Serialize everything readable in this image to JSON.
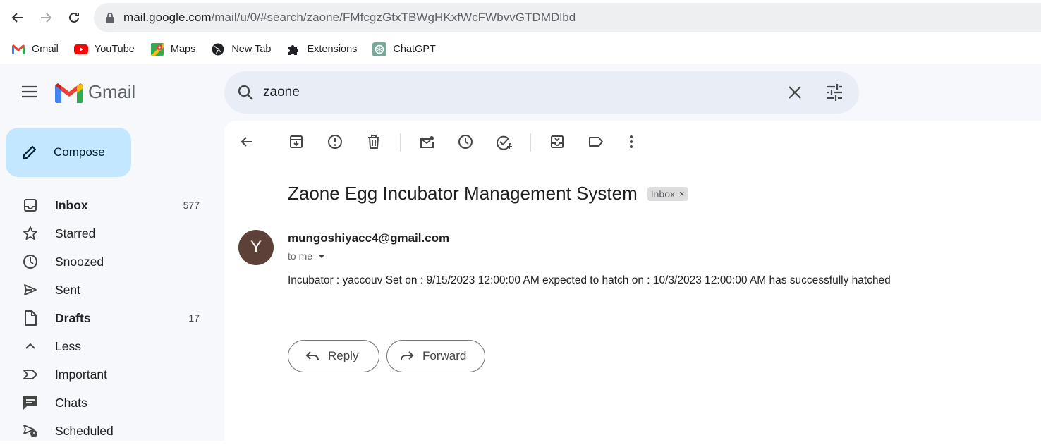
{
  "browser": {
    "url_host": "mail.google.com",
    "url_path": "/mail/u/0/#search/zaone/FMfcgzGtxTBWgHKxfWcFWbvvGTDMDlbd",
    "bookmarks": [
      "Gmail",
      "YouTube",
      "Maps",
      "New Tab",
      "Extensions",
      "ChatGPT"
    ]
  },
  "header": {
    "app_name": "Gmail",
    "search_value": "zaone"
  },
  "compose": {
    "label": "Compose"
  },
  "sidebar": {
    "items": [
      {
        "label": "Inbox",
        "count": "577",
        "icon": "inbox-icon"
      },
      {
        "label": "Starred",
        "count": "",
        "icon": "star-icon"
      },
      {
        "label": "Snoozed",
        "count": "",
        "icon": "clock-icon"
      },
      {
        "label": "Sent",
        "count": "",
        "icon": "send-icon"
      },
      {
        "label": "Drafts",
        "count": "17",
        "icon": "draft-icon"
      },
      {
        "label": "Less",
        "count": "",
        "icon": "chevron-up-icon"
      },
      {
        "label": "Important",
        "count": "",
        "icon": "important-icon"
      },
      {
        "label": "Chats",
        "count": "",
        "icon": "chat-icon"
      },
      {
        "label": "Scheduled",
        "count": "",
        "icon": "scheduled-send-icon"
      }
    ]
  },
  "email": {
    "subject": "Zaone Egg Incubator Management System",
    "label_badge": "Inbox",
    "badge_close": "×",
    "avatar_letter": "Y",
    "sender": "mungoshiyacc4@gmail.com",
    "recipient": "to me",
    "body": "Incubator : yaccouv Set on : 9/15/2023 12:00:00 AM expected to hatch on : 10/3/2023 12:00:00 AM has successfully hatched"
  },
  "actions": {
    "reply": "Reply",
    "forward": "Forward"
  },
  "colors": {
    "compose_bg": "#c2e7ff",
    "app_bg": "#f6f8fc",
    "search_bg": "#e9eef6",
    "avatar_bg": "#5d4037"
  }
}
